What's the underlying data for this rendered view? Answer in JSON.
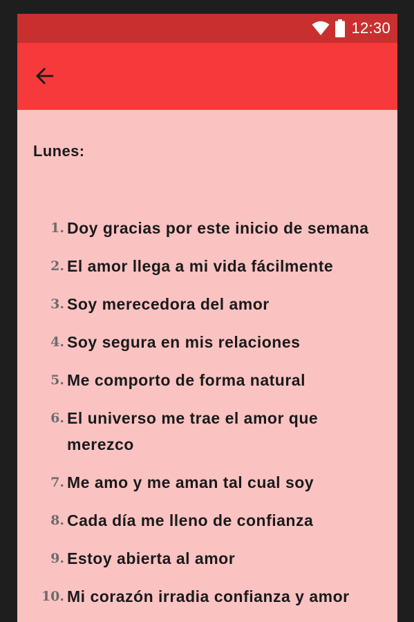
{
  "status_bar": {
    "time": "12:30",
    "icons": [
      "wifi-icon",
      "battery-icon"
    ]
  },
  "app_bar": {
    "back_icon": "arrow-back-icon"
  },
  "content": {
    "heading": "Lunes:",
    "items": [
      {
        "number": "1.",
        "text": "Doy gracias por este inicio de semana"
      },
      {
        "number": "2.",
        "text": "El amor llega a mi vida fácilmente"
      },
      {
        "number": "3.",
        "text": "Soy merecedora del amor"
      },
      {
        "number": "4.",
        "text": "Soy segura en mis relaciones"
      },
      {
        "number": "5.",
        "text": "Me comporto de forma natural"
      },
      {
        "number": "6.",
        "text": "El universo me trae el amor que merezco"
      },
      {
        "number": "7.",
        "text": "Me amo y me aman tal cual soy"
      },
      {
        "number": "8.",
        "text": "Cada día me lleno de confianza"
      },
      {
        "number": "9.",
        "text": "Estoy abierta al amor"
      },
      {
        "number": "10.",
        "text": "Mi corazón irradia confianza y amor"
      }
    ]
  },
  "colors": {
    "status_bar": "#c8302f",
    "app_bar": "#f6393a",
    "background": "#fbc2c2",
    "text": "#1a1a1a",
    "number": "#6c6c6c"
  }
}
